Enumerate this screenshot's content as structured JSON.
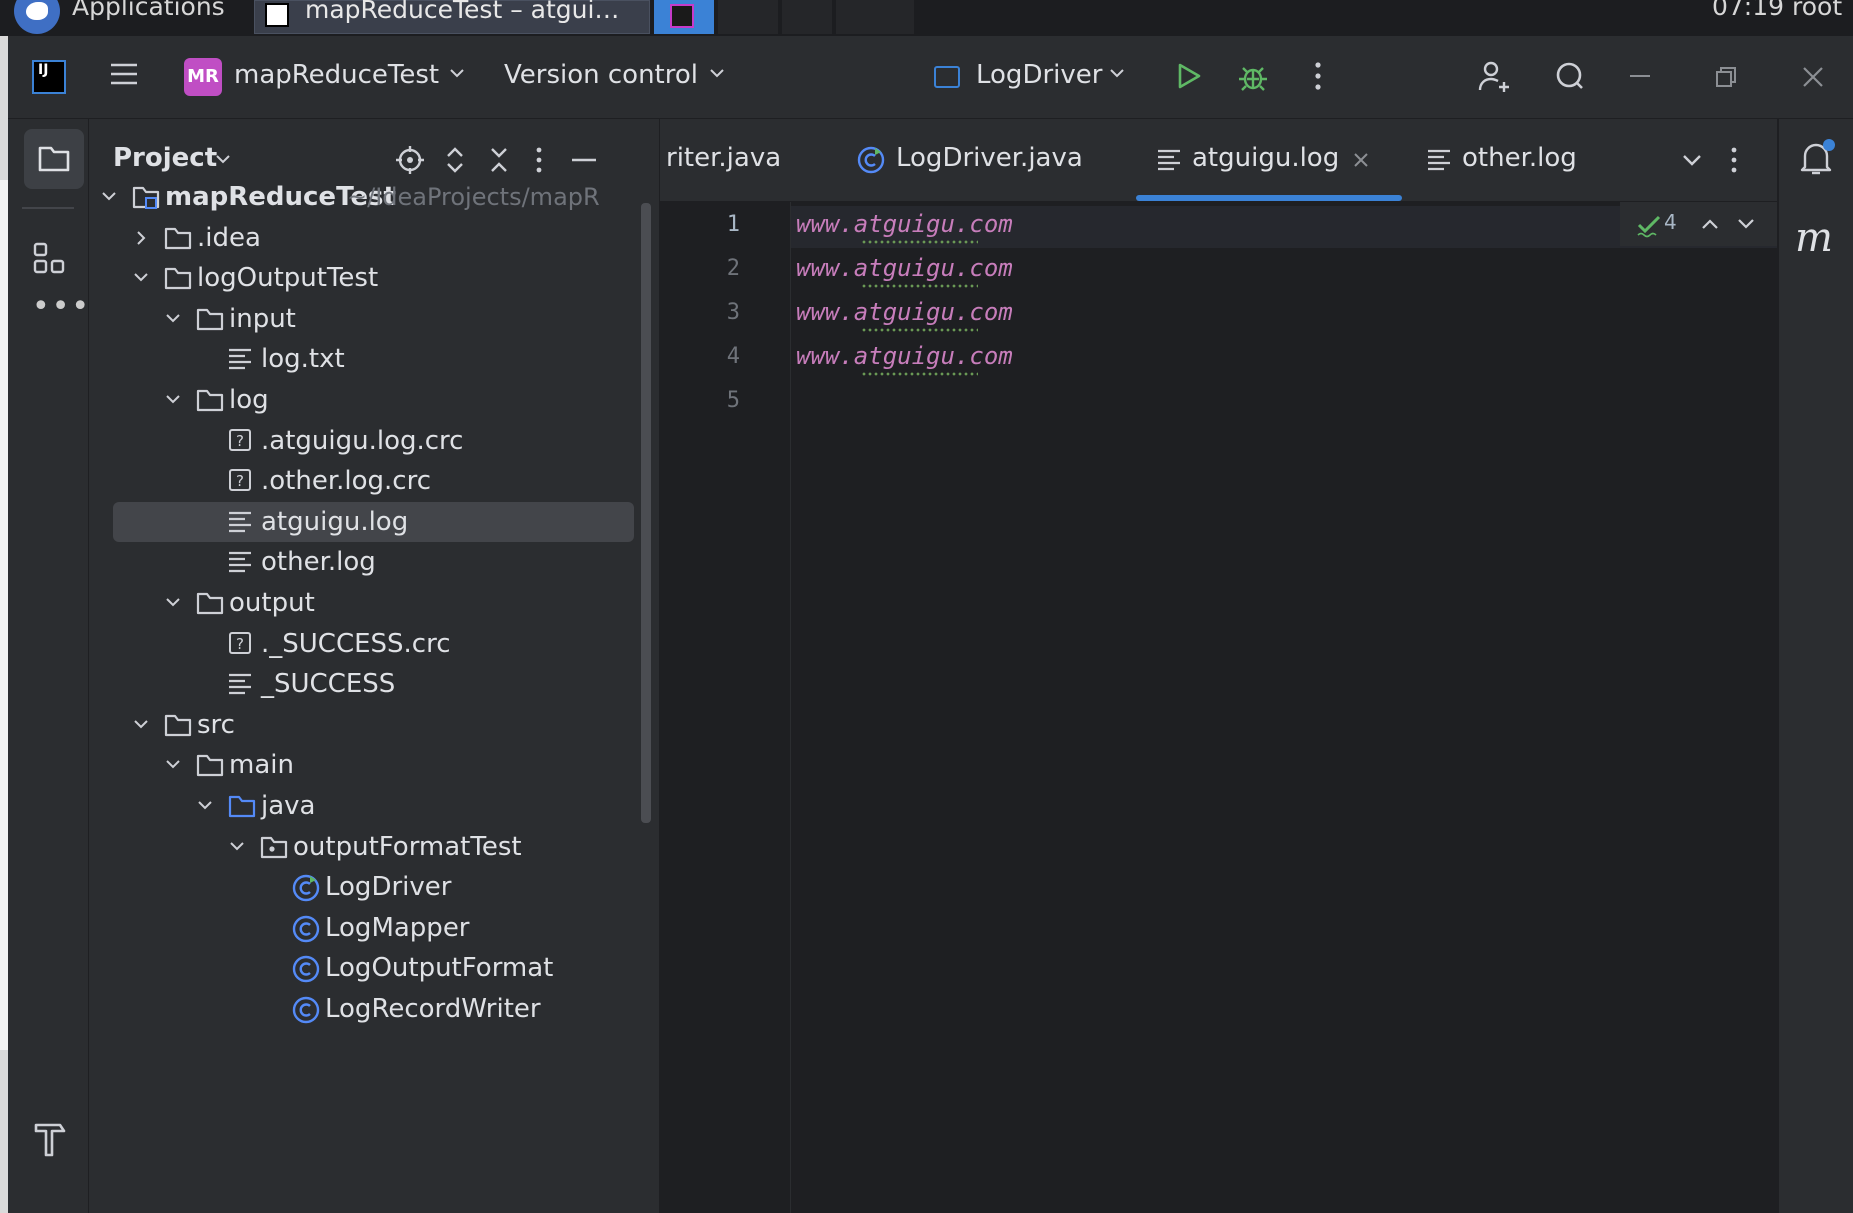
{
  "os": {
    "applications_label": "Applications",
    "task_title": "mapReduceTest – atgui…",
    "clock": "07:19  root"
  },
  "toolbar": {
    "project_badge": "MR",
    "project_name": "mapReduceTest",
    "version_control": "Version control",
    "run_config": "LogDriver"
  },
  "project_panel": {
    "title": "Project",
    "tree": [
      {
        "label": "mapReduceTest",
        "hint": "~/IdeaProjects/mapR",
        "depth": 0,
        "expanded": true,
        "icon": "module-folder-icon",
        "bold": true
      },
      {
        "label": ".idea",
        "depth": 1,
        "expanded": false,
        "icon": "folder-icon"
      },
      {
        "label": "logOutputTest",
        "depth": 1,
        "expanded": true,
        "icon": "folder-icon"
      },
      {
        "label": "input",
        "depth": 2,
        "expanded": true,
        "icon": "folder-icon"
      },
      {
        "label": "log.txt",
        "depth": 3,
        "icon": "text-file-icon"
      },
      {
        "label": "log",
        "depth": 2,
        "expanded": true,
        "icon": "folder-icon"
      },
      {
        "label": ".atguigu.log.crc",
        "depth": 3,
        "icon": "unknown-file-icon"
      },
      {
        "label": ".other.log.crc",
        "depth": 3,
        "icon": "unknown-file-icon"
      },
      {
        "label": "atguigu.log",
        "depth": 3,
        "icon": "text-file-icon",
        "selected": true
      },
      {
        "label": "other.log",
        "depth": 3,
        "icon": "text-file-icon"
      },
      {
        "label": "output",
        "depth": 2,
        "expanded": true,
        "icon": "folder-icon"
      },
      {
        "label": "._SUCCESS.crc",
        "depth": 3,
        "icon": "unknown-file-icon"
      },
      {
        "label": "_SUCCESS",
        "depth": 3,
        "icon": "text-file-icon"
      },
      {
        "label": "src",
        "depth": 1,
        "expanded": true,
        "icon": "folder-icon"
      },
      {
        "label": "main",
        "depth": 2,
        "expanded": true,
        "icon": "folder-icon"
      },
      {
        "label": "java",
        "depth": 3,
        "expanded": true,
        "icon": "source-folder-icon"
      },
      {
        "label": "outputFormatTest",
        "depth": 4,
        "expanded": true,
        "icon": "package-icon"
      },
      {
        "label": "LogDriver",
        "depth": 5,
        "icon": "runnable-class-icon"
      },
      {
        "label": "LogMapper",
        "depth": 5,
        "icon": "class-icon"
      },
      {
        "label": "LogOutputFormat",
        "depth": 5,
        "icon": "class-icon"
      },
      {
        "label": "LogRecordWriter",
        "depth": 5,
        "icon": "class-icon"
      }
    ]
  },
  "tabs": [
    {
      "label": "riter.java",
      "icon": ""
    },
    {
      "label": "LogDriver.java",
      "icon": "runnable-class-icon"
    },
    {
      "label": "atguigu.log",
      "icon": "text-file-icon",
      "active": true
    },
    {
      "label": "other.log",
      "icon": "text-file-icon"
    }
  ],
  "editor": {
    "line_numbers": [
      "1",
      "2",
      "3",
      "4",
      "5"
    ],
    "lines": [
      "www.atguigu.com",
      "www.atguigu.com",
      "www.atguigu.com",
      "www.atguigu.com",
      ""
    ],
    "inspection_count": "4"
  },
  "colors": {
    "accent": "#3b82d6",
    "badge": "#c04ec4",
    "code_text": "#c77dbb",
    "run_green": "#5fb865"
  }
}
